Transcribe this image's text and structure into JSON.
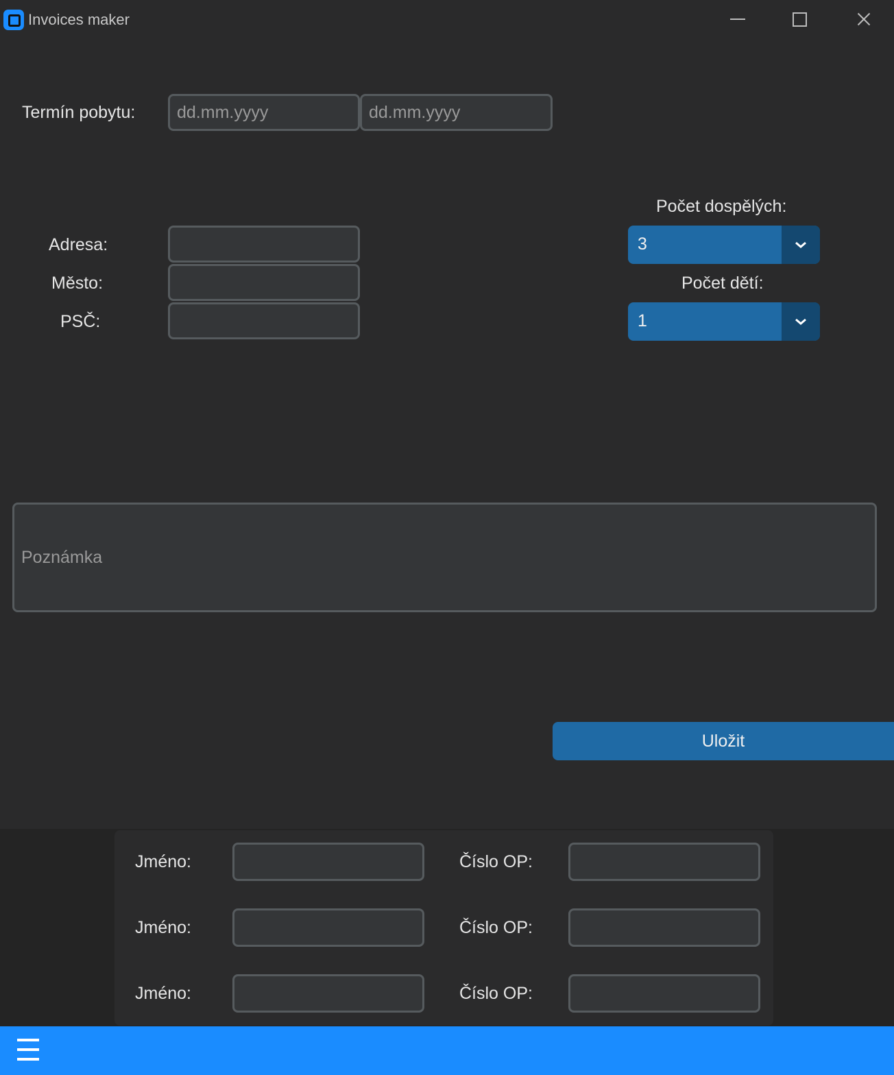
{
  "window": {
    "title": "Invoices maker"
  },
  "stay": {
    "label": "Termín pobytu:",
    "from_placeholder": "dd.mm.yyyy",
    "to_placeholder": "dd.mm.yyyy"
  },
  "address": {
    "street_label": "Adresa:",
    "city_label": "Město:",
    "zip_label": "PSČ:"
  },
  "counts": {
    "adults_label": "Počet dospělých:",
    "adults_value": "3",
    "children_label": "Počet dětí:",
    "children_value": "1"
  },
  "note": {
    "placeholder": "Poznámka"
  },
  "save_label": "Uložit",
  "guests": [
    {
      "name_label": "Jméno:",
      "id_label": "Číslo OP:"
    },
    {
      "name_label": "Jméno:",
      "id_label": "Číslo OP:"
    },
    {
      "name_label": "Jméno:",
      "id_label": "Číslo OP:"
    }
  ],
  "icons": {
    "menu": "hamburger-menu-icon",
    "dropdown": "chevron-down-icon",
    "app": "app-logo-icon"
  },
  "colors": {
    "accent": "#1f6aa5",
    "bottom_bar": "#1a8cff",
    "background": "#2a2a2b"
  }
}
